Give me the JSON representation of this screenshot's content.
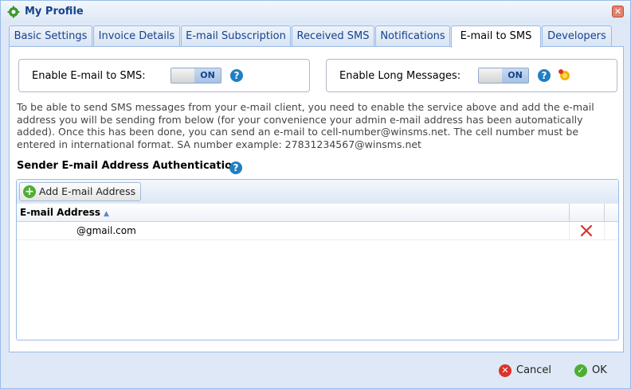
{
  "window": {
    "title": "My Profile"
  },
  "tabs": [
    {
      "label": "Basic Settings"
    },
    {
      "label": "Invoice Details"
    },
    {
      "label": "E-mail Subscription"
    },
    {
      "label": "Received SMS"
    },
    {
      "label": "Notifications"
    },
    {
      "label": "E-mail to SMS",
      "active": true
    },
    {
      "label": "Developers"
    }
  ],
  "options": {
    "email_to_sms": {
      "label": "Enable E-mail to SMS:",
      "state": "ON"
    },
    "long_messages": {
      "label": "Enable Long Messages:",
      "state": "ON"
    }
  },
  "description": "To be able to send SMS messages from your e-mail client, you need to enable the service above and add the e-mail address you will be sending from below (for your convenience your admin e-mail address has been automatically added). Once this has been done, you can send an e-mail to cell-number@winsms.net. The cell number must be entered in international format. SA number example: 27831234567@winsms.net",
  "section": {
    "title": "Sender E-mail Address Authentication"
  },
  "grid": {
    "add_button": "Add E-mail Address",
    "column_header": "E-mail Address",
    "rows": [
      {
        "email": "@gmail.com"
      }
    ]
  },
  "footer": {
    "cancel": "Cancel",
    "ok": "OK"
  },
  "colors": {
    "accent": "#15428b",
    "border": "#99bbe8",
    "ok": "#4caf32",
    "cancel": "#d9342b"
  }
}
